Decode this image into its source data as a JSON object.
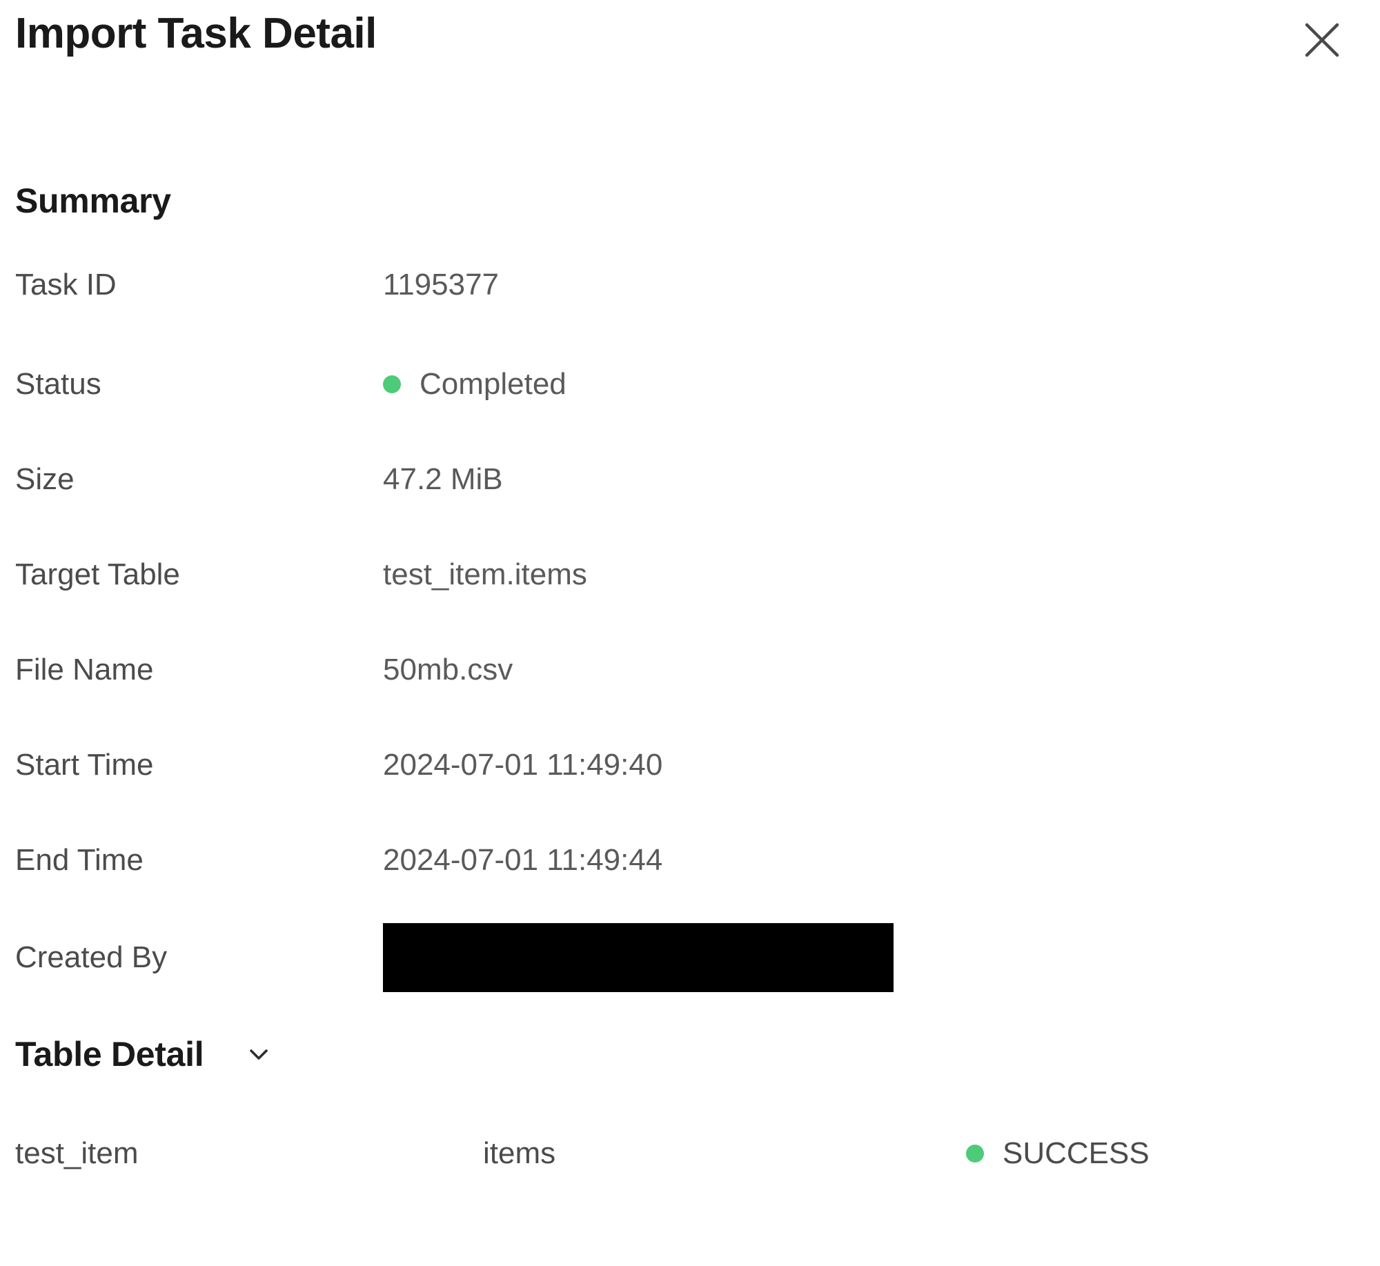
{
  "header": {
    "title": "Import Task Detail",
    "close_icon": "close-icon"
  },
  "summary": {
    "heading": "Summary",
    "rows": [
      {
        "label": "Task ID",
        "value": "1195377"
      },
      {
        "label": "Status",
        "value": "Completed",
        "dot_color": "#4ECB79"
      },
      {
        "label": "Size",
        "value": "47.2 MiB"
      },
      {
        "label": "Target Table",
        "value": "test_item.items"
      },
      {
        "label": "File Name",
        "value": "50mb.csv"
      },
      {
        "label": "Start Time",
        "value": "2024-07-01 11:49:40"
      },
      {
        "label": "End Time",
        "value": "2024-07-01 11:49:44"
      },
      {
        "label": "Created By",
        "value": ""
      }
    ]
  },
  "table_detail": {
    "heading": "Table Detail",
    "toggle_icon": "chevron-down-icon",
    "rows": [
      {
        "schema": "test_item",
        "table": "items",
        "status": "SUCCESS",
        "dot_color": "#4ECB79"
      }
    ]
  },
  "colors": {
    "success_green": "#4ECB79",
    "label_text": "#4b4b4b",
    "value_text": "#5a5a5a",
    "heading_text": "#1a1a1a",
    "redaction": "#000000",
    "background": "#ffffff"
  }
}
